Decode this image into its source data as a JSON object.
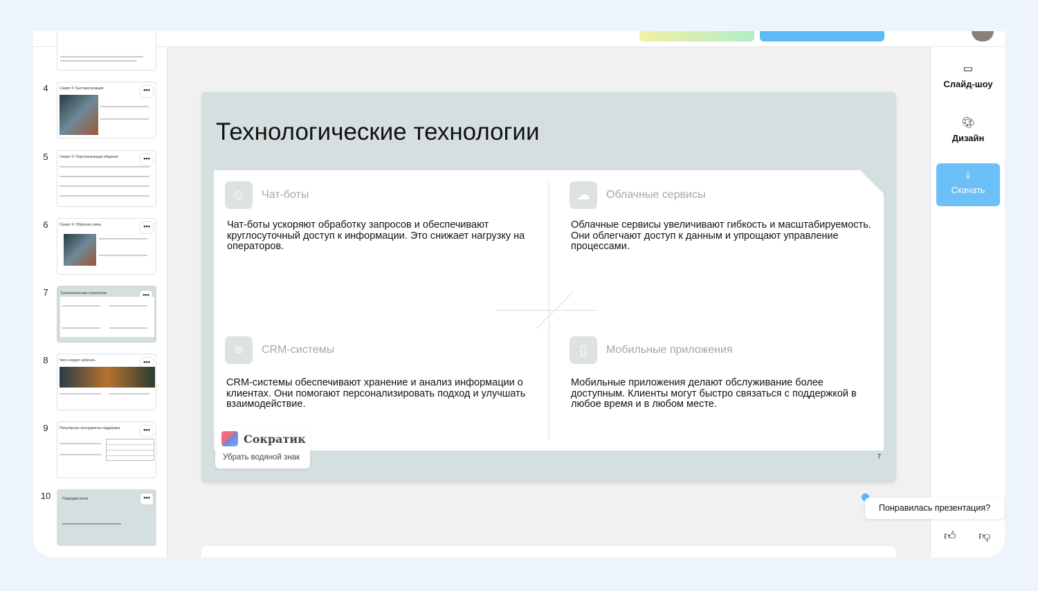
{
  "sidebar": {
    "slides": [
      {
        "number": "4",
        "title": "Секрет 2: Быстрая реакция"
      },
      {
        "number": "5",
        "title": "Секрет 3: Персонализация общения"
      },
      {
        "number": "6",
        "title": "Секрет 4: Обратная связь"
      },
      {
        "number": "7",
        "title": "Технологические технологии"
      },
      {
        "number": "8",
        "title": "Чего следует избегать"
      },
      {
        "number": "9",
        "title": "Популярные инструменты поддержки"
      },
      {
        "number": "10",
        "title": "Подводим итоги"
      }
    ],
    "more_label": "•••"
  },
  "slide": {
    "title": "Технологические технологии",
    "features": [
      {
        "icon": "robot-icon",
        "heading": "Чат-боты",
        "body": "Чат-боты ускоряют обработку запросов и обеспечивают круглосуточный доступ к информации. Это снижает нагрузку на операторов."
      },
      {
        "icon": "cloud-icon",
        "heading": "Облачные сервисы",
        "body": "Облачные сервисы увеличивают гибкость и масштабируемость. Они облегчают доступ к данным и упрощают управление процессами."
      },
      {
        "icon": "database-icon",
        "heading": "CRM-системы",
        "body": "CRM-системы обеспечивают хранение и анализ информации о клиентах. Они помогают персонализировать подход и улучшать взаимодействие."
      },
      {
        "icon": "smartphone-icon",
        "heading": "Мобильные приложения",
        "body": "Мобильные приложения делают обслуживание более доступным. Клиенты могут быстро связаться с поддержкой в любое время и в любом месте."
      }
    ],
    "page_number": "7",
    "watermark": {
      "brand": "Сократик",
      "remove_label": "Убрать водяной знак"
    }
  },
  "right_panel": {
    "slideshow_label": "Слайд-шоу",
    "design_label": "Дизайн",
    "download_label": "Скачать"
  },
  "feedback": {
    "question": "Понравилась презентация?"
  },
  "colors": {
    "accent": "#6cc0f7",
    "slide_bg": "#d5dfdf"
  }
}
